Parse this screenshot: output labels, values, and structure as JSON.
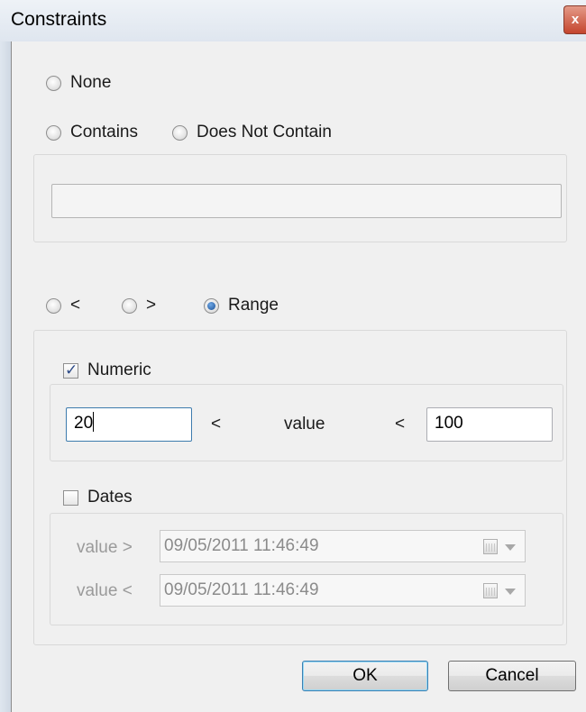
{
  "window": {
    "title": "Constraints",
    "close_glyph": "x"
  },
  "options": {
    "none": "None",
    "contains": "Contains",
    "does_not_contain": "Does Not Contain",
    "less_than": "<",
    "greater_than": ">",
    "range": "Range",
    "selected": "Range"
  },
  "text_filter": {
    "value": ""
  },
  "range": {
    "numeric_label": "Numeric",
    "numeric_checked": true,
    "min_value": "20",
    "op1": "<",
    "value_label": "value",
    "op2": "<",
    "max_value": "100",
    "dates_label": "Dates",
    "dates_checked": false,
    "date_after_label": "value >",
    "date_after": "09/05/2011 11:46:49",
    "date_before_label": "value <",
    "date_before": "09/05/2011 11:46:49"
  },
  "buttons": {
    "ok": "OK",
    "cancel": "Cancel"
  },
  "icons": {
    "close": "close-icon",
    "calendar": "calendar-icon",
    "dropdown": "chevron-down-icon"
  }
}
